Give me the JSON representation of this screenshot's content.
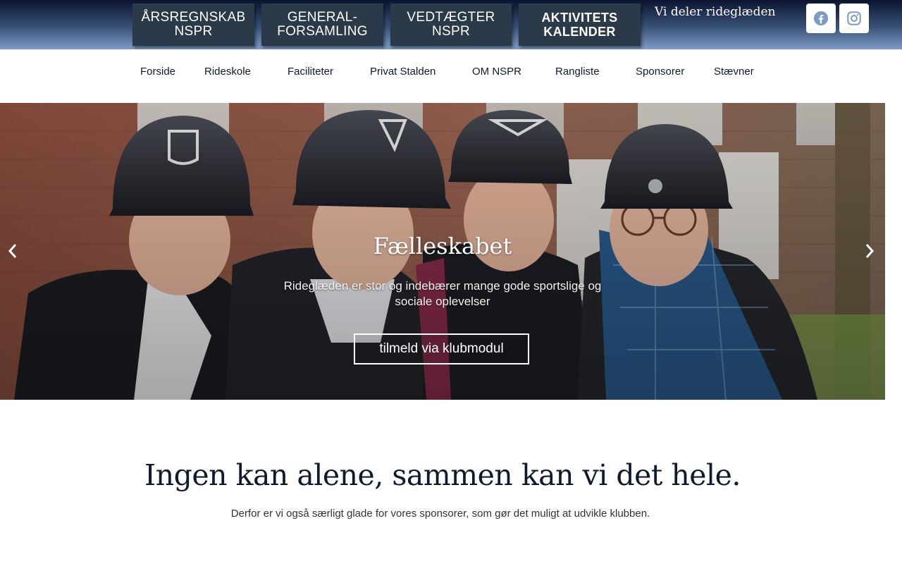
{
  "top_buttons": [
    {
      "lines": [
        "ÅRSREGNSKAB",
        "NSPR"
      ]
    },
    {
      "lines": [
        "GENERAL-",
        "FORSAMLING"
      ]
    },
    {
      "lines": [
        "VEDTÆGTER",
        "NSPR"
      ]
    },
    {
      "lines": [
        "AKTIVITETS",
        "KALENDER"
      ]
    }
  ],
  "tagline": "Vi deler rideglæden",
  "social": {
    "facebook_icon": "facebook-icon",
    "instagram_icon": "instagram-icon"
  },
  "nav": {
    "items": [
      "Forside",
      "Rideskole",
      "Faciliteter",
      "Privat Stalden",
      "OM NSPR",
      "Rangliste",
      "Sponsorer",
      "Stævner"
    ]
  },
  "hero": {
    "title": "Fælleskabet",
    "subtitle": "Rideglæden er stor og indebærer mange gode sportslige og sociale oplevelser",
    "cta_label": "tilmeld via klubmodul"
  },
  "section": {
    "title": "Ingen kan alene, sammen kan vi det hele.",
    "text": "Derfor er vi også særligt glade for vores sponsorer, som gør det muligt at udvikle klubben."
  },
  "colors": {
    "header_top": "#0a1430",
    "header_bottom": "#7d9cc4",
    "button_bg": "#2a3a48",
    "social_icon": "#7d9cc4",
    "text_dark": "#0f1a2e"
  }
}
